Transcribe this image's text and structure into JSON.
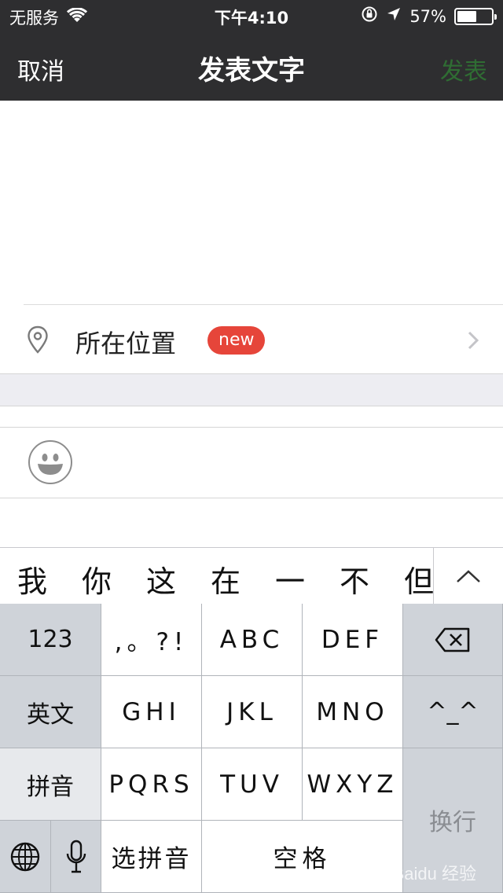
{
  "status_bar": {
    "carrier": "无服务",
    "time": "下午4:10",
    "battery_percent": "57%",
    "battery_level": 0.57,
    "icons": [
      "wifi-icon",
      "orientation-lock-icon",
      "location-arrow-icon",
      "battery-icon"
    ]
  },
  "nav": {
    "cancel": "取消",
    "title": "发表文字",
    "publish": "发表"
  },
  "location": {
    "label": "所在位置",
    "badge": "new"
  },
  "candidates": [
    "我",
    "你",
    "这",
    "在",
    "一",
    "不",
    "但"
  ],
  "keyboard": {
    "num": "123",
    "punct": ",。?!",
    "abc": "ABC",
    "def": "DEF",
    "english": "英文",
    "ghi": "GHI",
    "jkl": "JKL",
    "mno": "MNO",
    "emoticon": "^_^",
    "pinyin": "拼音",
    "pqrs": "PQRS",
    "tuv": "TUV",
    "wxyz": "WXYZ",
    "enter": "换行",
    "select_pinyin": "选拼音",
    "space": "空格"
  },
  "colors": {
    "nav_bg": "#2e2e30",
    "publish_disabled": "#2f6d33",
    "badge": "#e6453a"
  }
}
